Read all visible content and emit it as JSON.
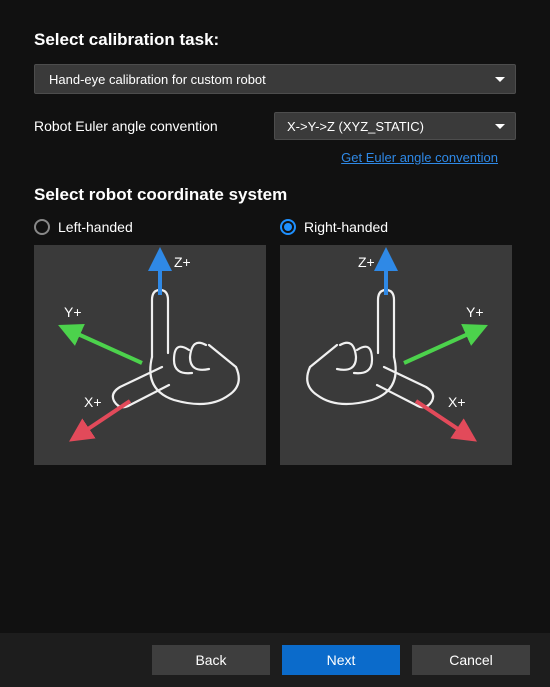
{
  "headings": {
    "select_task": "Select calibration task:",
    "select_coord": "Select robot coordinate system"
  },
  "task_dropdown": {
    "value": "Hand-eye calibration for custom robot"
  },
  "euler": {
    "label": "Robot Euler angle convention",
    "value": "X->Y->Z (XYZ_STATIC)"
  },
  "help_link": "Get Euler angle convention",
  "coord": {
    "left_handed_label": "Left-handed",
    "right_handed_label": "Right-handed",
    "selected": "right"
  },
  "diagram": {
    "z_label": "Z+",
    "y_label": "Y+",
    "x_label": "X+"
  },
  "footer": {
    "back": "Back",
    "next": "Next",
    "cancel": "Cancel"
  }
}
